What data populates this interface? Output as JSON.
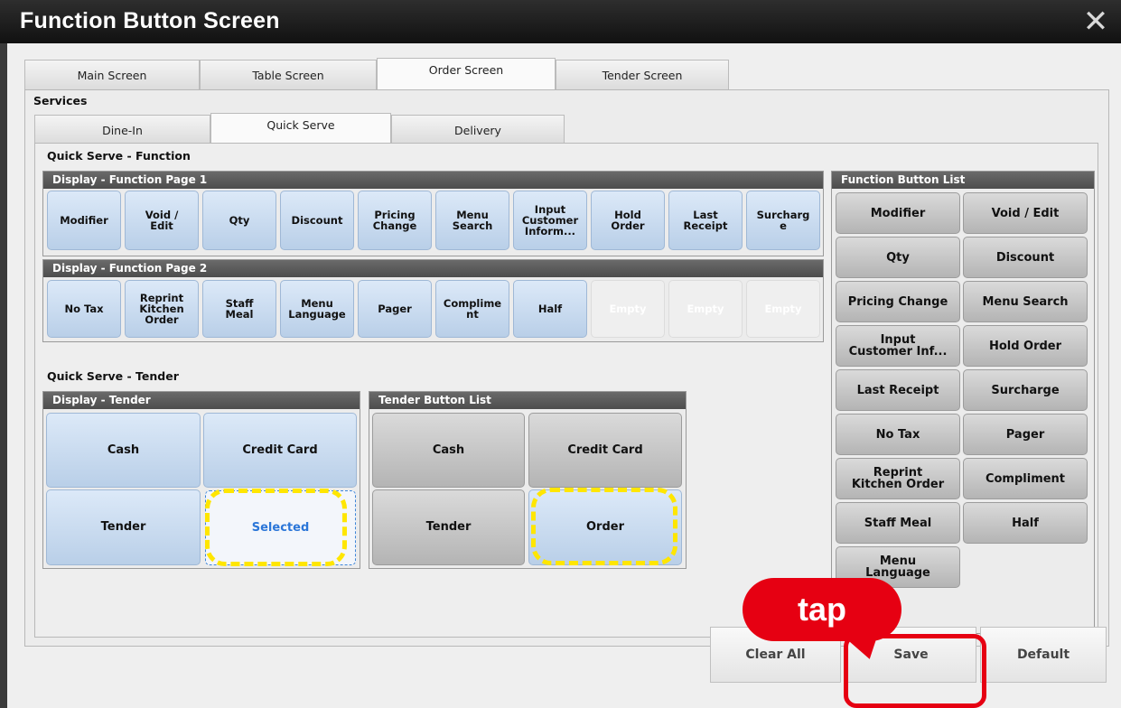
{
  "title": "Function Button Screen",
  "top_tabs": [
    "Main Screen",
    "Table Screen",
    "Order Screen",
    "Tender Screen"
  ],
  "services_label": "Services",
  "service_tabs": [
    "Dine-In",
    "Quick Serve",
    "Delivery"
  ],
  "function_section_label": "Quick Serve - Function",
  "page1": {
    "header": "Display - Function Page 1",
    "buttons": [
      "Modifier",
      "Void /\nEdit",
      "Qty",
      "Discount",
      "Pricing\nChange",
      "Menu\nSearch",
      "Input\nCustomer\nInform...",
      "Hold\nOrder",
      "Last\nReceipt",
      "Surcharg\ne"
    ]
  },
  "page2": {
    "header": "Display - Function Page 2",
    "buttons": [
      "No Tax",
      "Reprint\nKitchen\nOrder",
      "Staff\nMeal",
      "Menu\nLanguage",
      "Pager",
      "Complime\nnt",
      "Half",
      "Empty",
      "Empty",
      "Empty"
    ]
  },
  "tender_section_label": "Quick Serve - Tender",
  "display_tender": {
    "header": "Display - Tender",
    "buttons": [
      "Cash",
      "Credit Card",
      "Tender",
      "Selected"
    ]
  },
  "tender_list": {
    "header": "Tender Button List",
    "buttons": [
      "Cash",
      "Credit Card",
      "Tender",
      "Order"
    ]
  },
  "function_list": {
    "header": "Function Button List",
    "buttons": [
      "Modifier",
      "Void / Edit",
      "Qty",
      "Discount",
      "Pricing Change",
      "Menu Search",
      "Input\nCustomer Inf...",
      "Hold Order",
      "Last Receipt",
      "Surcharge",
      "No Tax",
      "Pager",
      "Reprint\nKitchen Order",
      "Compliment",
      "Staff Meal",
      "Half",
      "Menu\nLanguage"
    ]
  },
  "bottom_buttons": {
    "clear_all": "Clear All",
    "save": "Save",
    "default": "Default"
  },
  "callout": "tap",
  "colors": {
    "highlight": "#ffe600",
    "callout": "#e60012"
  }
}
